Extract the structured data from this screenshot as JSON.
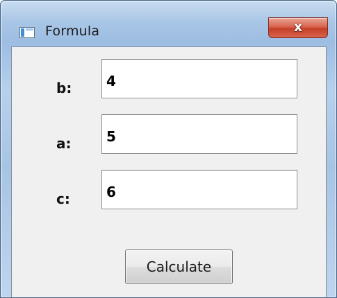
{
  "window": {
    "title": "Formula",
    "close_glyph": "x",
    "icon": "app-window-icon"
  },
  "form": {
    "fields": [
      {
        "label": "b:",
        "value": "4"
      },
      {
        "label": "a:",
        "value": "5"
      },
      {
        "label": "c:",
        "value": "6"
      }
    ],
    "calculate_label": "Calculate"
  },
  "colors": {
    "close_button": "#c53f27",
    "frame": "#a9c6e6",
    "client_background": "#f0f0f0"
  }
}
